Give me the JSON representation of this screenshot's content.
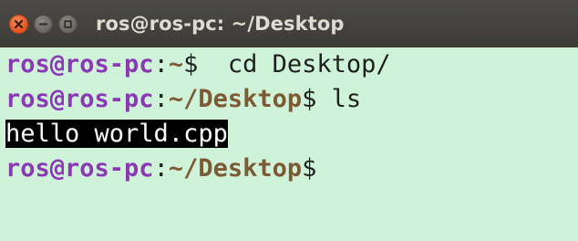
{
  "window": {
    "title": "ros@ros-pc: ~/Desktop",
    "buttons": {
      "close_icon": "close-icon",
      "minimize_icon": "minimize-icon",
      "maximize_icon": "maximize-icon"
    },
    "colors": {
      "titlebar": "#3c3b37",
      "terminal_background": "#cff3d9",
      "user_host": "#8b38b6",
      "path": "#7b5a34",
      "text": "#1f1f1f",
      "highlight_bg": "#000000",
      "highlight_fg": "#ffffff"
    }
  },
  "terminal": {
    "lines": [
      {
        "user_host": "ros@ros-pc",
        "colon": ":",
        "path": "~",
        "prompt_symbol": "$",
        "command": "  cd Desktop/"
      },
      {
        "user_host": "ros@ros-pc",
        "colon": ":",
        "path": "~/Desktop",
        "prompt_symbol": "$",
        "command": " ls"
      },
      {
        "output": "hello world.cpp"
      },
      {
        "user_host": "ros@ros-pc",
        "colon": ":",
        "path": "~/Desktop",
        "prompt_symbol": "$",
        "command": ""
      }
    ]
  }
}
